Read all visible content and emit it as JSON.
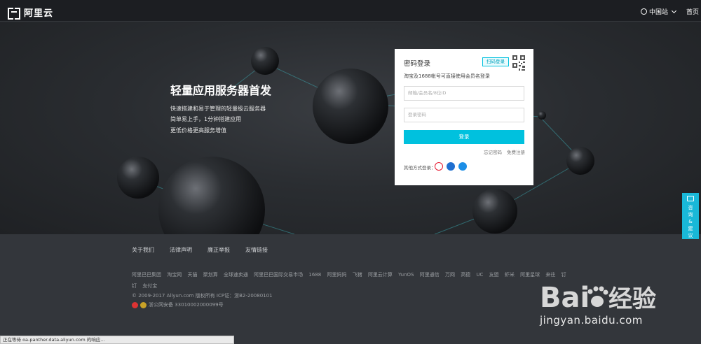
{
  "header": {
    "logo_text": "阿里云",
    "region": "中国站",
    "home": "首页"
  },
  "hero": {
    "title": "轻量应用服务器首发",
    "lines": [
      "快速搭建和易于管理的轻量级云服务器",
      "简单易上手，1分钟搭建应用",
      "更低价格更高服务增值"
    ]
  },
  "login": {
    "title": "密码登录",
    "qr_tag": "扫码登录",
    "hint": "淘宝及1688帐号可直接使用会员名登录",
    "username_placeholder": "邮箱/会员名/8位ID",
    "password_placeholder": "登录密码",
    "submit": "登录",
    "forgot": "忘记密码",
    "register": "免费注册",
    "other_login": "其他方式登录："
  },
  "footer": {
    "nav": [
      "关于我们",
      "法律声明",
      "廉正举报",
      "友情链接"
    ],
    "links": [
      "阿里巴巴集团",
      "淘宝网",
      "天猫",
      "聚划算",
      "全球速卖通",
      "阿里巴巴国际交易市场",
      "1688",
      "阿里妈妈",
      "飞猪",
      "阿里云计算",
      "YunOS",
      "阿里通信",
      "万网",
      "高德",
      "UC",
      "友盟",
      "虾米",
      "阿里星球",
      "来往",
      "钉钉",
      "支付宝"
    ],
    "copyright": "© 2009-2017 Aliyun.com 版权所有 ICP证：浙B2-20080101",
    "beian": "浙公网安备 33010002000099号"
  },
  "side_tab": {
    "text": "咨询&建议"
  },
  "status_bar": {
    "text": "正在等待 oa-panther.data.aliyun.com 的响应..."
  },
  "watermark": {
    "url": "jingyan.baidu.com"
  },
  "colors": {
    "accent": "#00c1de",
    "header_bg": "#1c1e22",
    "footer_bg": "#33363b",
    "side_tab": "#19b8d8"
  }
}
